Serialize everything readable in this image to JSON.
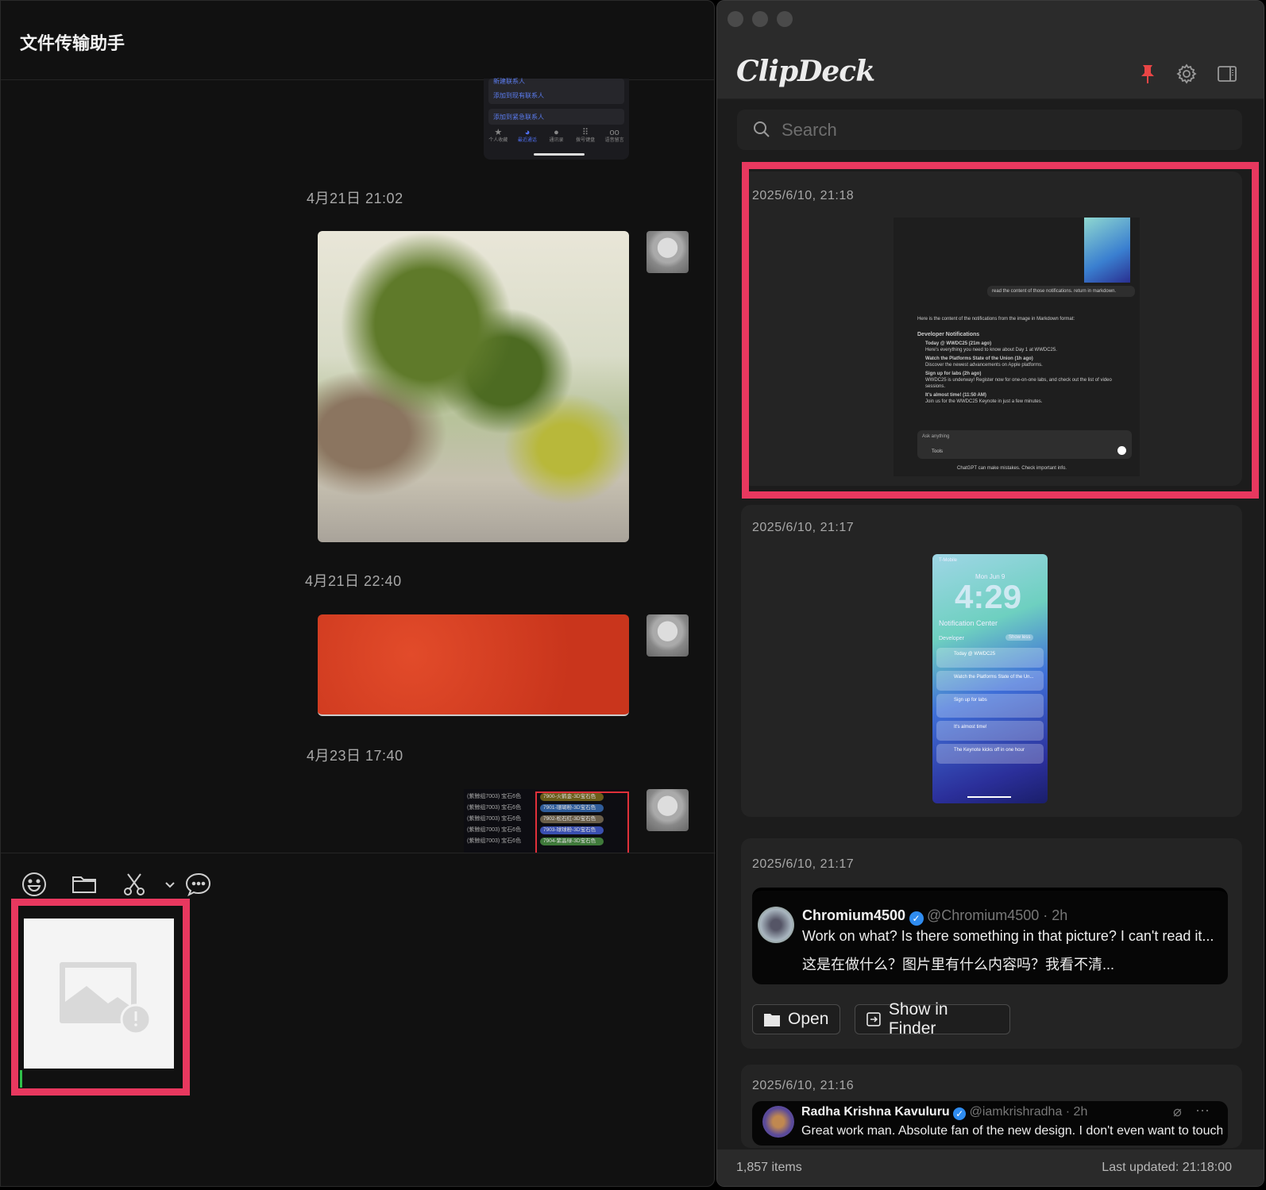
{
  "chat": {
    "title": "文件传输助手",
    "messages": [
      {
        "timestamp": "4月21日 21:02",
        "type": "image",
        "description_icon": "landscape-painting"
      },
      {
        "timestamp": "4月21日 22:40",
        "type": "image"
      },
      {
        "timestamp": "4月23日 17:40",
        "type": "image"
      }
    ],
    "phone_screenshot": {
      "lines": [
        "新建联系人",
        "添加到现有联系人",
        "添加到紧急联系人"
      ],
      "tabs": [
        "个人收藏",
        "最近通话",
        "通讯录",
        "拨号键盘",
        "语音留言"
      ]
    },
    "table_screenshot": {
      "left_cells": [
        "(紫鲸组7003) 宝石6色",
        "(紫鲸组7003) 宝石6色",
        "(紫鲸组7003) 宝石6色",
        "(紫鲸组7003) 宝石6色",
        "(紫鲸组7003) 宝石6色"
      ],
      "pills": [
        "7900-火鹤金-3D宝石色",
        "7901-珊瑚粉-3D宝石色",
        "7902-松石红-3D宝石色",
        "7903-球球粉-3D宝石色",
        "7904-紫晶绿-3D宝石色"
      ],
      "pill_colors": [
        "#6b5d1a",
        "#2f5c9a",
        "#6a5e4a",
        "#3a4fb0",
        "#3f7a3a"
      ]
    },
    "toolbar": [
      "emoji-icon",
      "folder-icon",
      "scissors-icon",
      "chevron-down-icon",
      "chat-bubble-icon"
    ],
    "highlight_color": "#e8385f"
  },
  "clipdeck": {
    "app_name": "ClipDeck",
    "search_placeholder": "Search",
    "pin_color": "#e84545",
    "items": [
      {
        "timestamp": "2025/6/10, 21:18",
        "gpt": {
          "user_msg": "read the content of those notifications. return in markdown.",
          "intro": "Here is the content of the notifications from the image in Markdown format:",
          "heading": "Developer Notifications",
          "bullets": [
            {
              "title": "Today @ WWDC25 (21m ago)",
              "body": "Here's everything you need to know about Day 1 at WWDC25."
            },
            {
              "title": "Watch the Platforms State of the Union (1h ago)",
              "body": "Discover the newest advancements on Apple platforms."
            },
            {
              "title": "Sign up for labs (2h ago)",
              "body": "WWDC25 is underway! Register now for one-on-one labs, and check out the list of video sessions."
            },
            {
              "title": "It's almost time! (11:50 AM)",
              "body": "Join us for the WWDC25 Keynote in just a few minutes."
            }
          ],
          "input_placeholder": "Ask anything",
          "tools_label": "Tools",
          "disclaimer": "ChatGPT can make mistakes. Check important info."
        }
      },
      {
        "timestamp": "2025/6/10, 21:17",
        "lockscreen": {
          "carrier": "T-Mobile",
          "date": "Mon Jun 9",
          "time": "4:29",
          "header": "Notification Center",
          "group": "Developer",
          "show_less": "Show less",
          "notifications": [
            "Today @ WWDC25",
            "Watch the Platforms State of the Un...",
            "Sign up for labs",
            "It's almost time!",
            "The Keynote kicks off in one hour"
          ]
        }
      },
      {
        "timestamp": "2025/6/10, 21:17",
        "tweet": {
          "name": "Chromium4500",
          "handle": "@Chromium4500 · 2h",
          "text": "Work on what? Is there something in that picture? I can't read it...",
          "translation": "这是在做什么？图片里有什么内容吗？我看不清..."
        },
        "actions": {
          "open": "Open",
          "show_in_finder": "Show in Finder"
        }
      },
      {
        "timestamp": "2025/6/10, 21:16",
        "tweet": {
          "name": "Radha Krishna Kavuluru",
          "handle": "@iamkrishradha · 2h",
          "text": "Great work man. Absolute fan of the new design. I don't even want to touch"
        }
      }
    ],
    "footer": {
      "count": "1,857 items",
      "updated": "Last updated: 21:18:00"
    }
  }
}
